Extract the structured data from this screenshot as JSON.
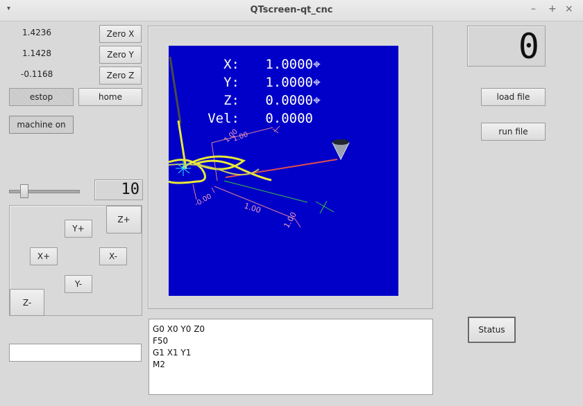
{
  "window": {
    "title": "QTscreen-qt_cnc",
    "menu_glyph": "▾",
    "minimize_glyph": "–",
    "maximize_glyph": "+",
    "close_glyph": "×"
  },
  "positions": {
    "x": "1.4236",
    "y": "1.1428",
    "z": "-0.1168"
  },
  "buttons": {
    "zero_x": "Zero X",
    "zero_y": "Zero Y",
    "zero_z": "Zero Z",
    "estop": "estop",
    "home": "home",
    "machine_on": "machine on",
    "load_file": "load file",
    "run_file": "run file",
    "status": "Status"
  },
  "jog": {
    "y_plus": "Y+",
    "y_minus": "Y-",
    "x_plus": "X+",
    "x_minus": "X-",
    "z_plus": "Z+",
    "z_minus": "Z-"
  },
  "jog_rate": {
    "value": "10",
    "slider_fraction": 0.18
  },
  "counter": {
    "value": "0"
  },
  "dro": {
    "rows": [
      {
        "axis": "X:",
        "value": "1.0000",
        "homed": true
      },
      {
        "axis": "Y:",
        "value": "1.0000",
        "homed": true
      },
      {
        "axis": "Z:",
        "value": "0.0000",
        "homed": true
      },
      {
        "axis": "Vel:",
        "value": "0.0000",
        "homed": false
      }
    ],
    "homed_symbol": "⌖"
  },
  "plot_labels": {
    "dim_a": "1.00",
    "dim_b": "1.00",
    "dim_c": "-0.00",
    "dim_d": "1.00",
    "dim_e": "1.00"
  },
  "gcode": {
    "lines": [
      "G0 X0 Y0 Z0",
      "F50",
      "G1 X1 Y1",
      "M2"
    ]
  },
  "mdi": {
    "value": "",
    "placeholder": ""
  },
  "colors": {
    "viewport_bg": "#0000c8",
    "toolpath": "#e8e838",
    "axis_x": "#e05050",
    "axis_y": "#40c040",
    "dim_lines": "#f0a0c0"
  }
}
